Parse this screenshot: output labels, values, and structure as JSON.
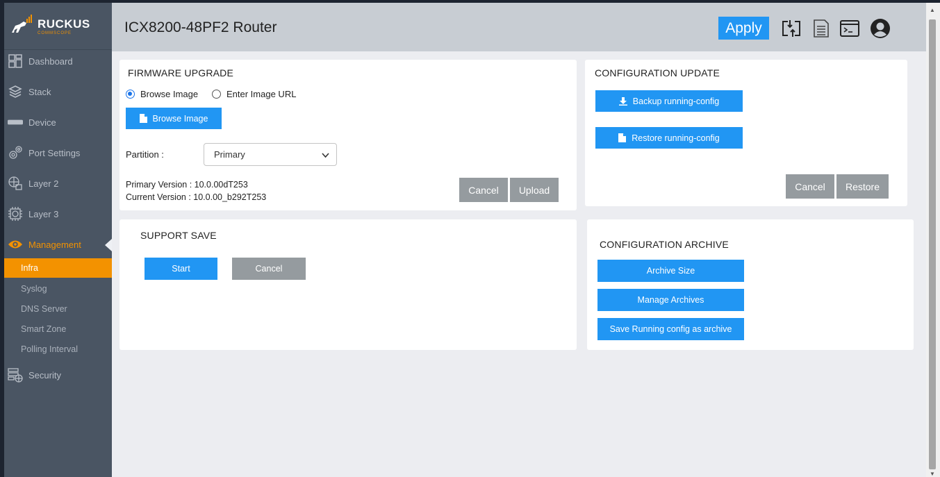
{
  "app": {
    "brand": "RUCKUS",
    "brand_sub": "COMMSCOPE",
    "title": "ICX8200-48PF2 Router",
    "apply_label": "Apply",
    "accent_color": "#2196f3",
    "active_color": "#f39200"
  },
  "header_icons": [
    "switch-icon",
    "save-icon",
    "cli-terminal-icon",
    "user-avatar-icon"
  ],
  "sidebar": {
    "items": [
      {
        "label": "Dashboard",
        "icon": "dashboard-icon"
      },
      {
        "label": "Stack",
        "icon": "stack-layers-icon"
      },
      {
        "label": "Device",
        "icon": "device-icon"
      },
      {
        "label": "Port Settings",
        "icon": "gears-icon"
      },
      {
        "label": "Layer 2",
        "icon": "layer2-icon"
      },
      {
        "label": "Layer 3",
        "icon": "layer3-icon"
      },
      {
        "label": "Management",
        "icon": "eye-icon"
      },
      {
        "label": "Security",
        "icon": "security-icon"
      }
    ],
    "sub_items": [
      {
        "label": "Infra"
      },
      {
        "label": "Syslog"
      },
      {
        "label": "DNS Server"
      },
      {
        "label": "Smart Zone"
      },
      {
        "label": "Polling Interval"
      }
    ]
  },
  "firmware": {
    "title": "FIRMWARE UPGRADE",
    "radio_browse": "Browse Image",
    "radio_url": "Enter Image URL",
    "browse_button": "Browse Image",
    "partition_label": "Partition :",
    "partition_value": "Primary",
    "primary_version": "Primary Version : 10.0.00dT253",
    "current_version": "Current Version : 10.0.00_b292T253",
    "cancel": "Cancel",
    "upload": "Upload"
  },
  "config_update": {
    "title": "CONFIGURATION UPDATE",
    "backup": "Backup running-config",
    "restore_config": "Restore running-config",
    "cancel": "Cancel",
    "restore": "Restore"
  },
  "support_save": {
    "title": "SUPPORT SAVE",
    "start": "Start",
    "cancel": "Cancel"
  },
  "config_archive": {
    "title": "CONFIGURATION ARCHIVE",
    "archive_size": "Archive Size",
    "manage_archives": "Manage Archives",
    "save_running": "Save Running config as archive"
  }
}
